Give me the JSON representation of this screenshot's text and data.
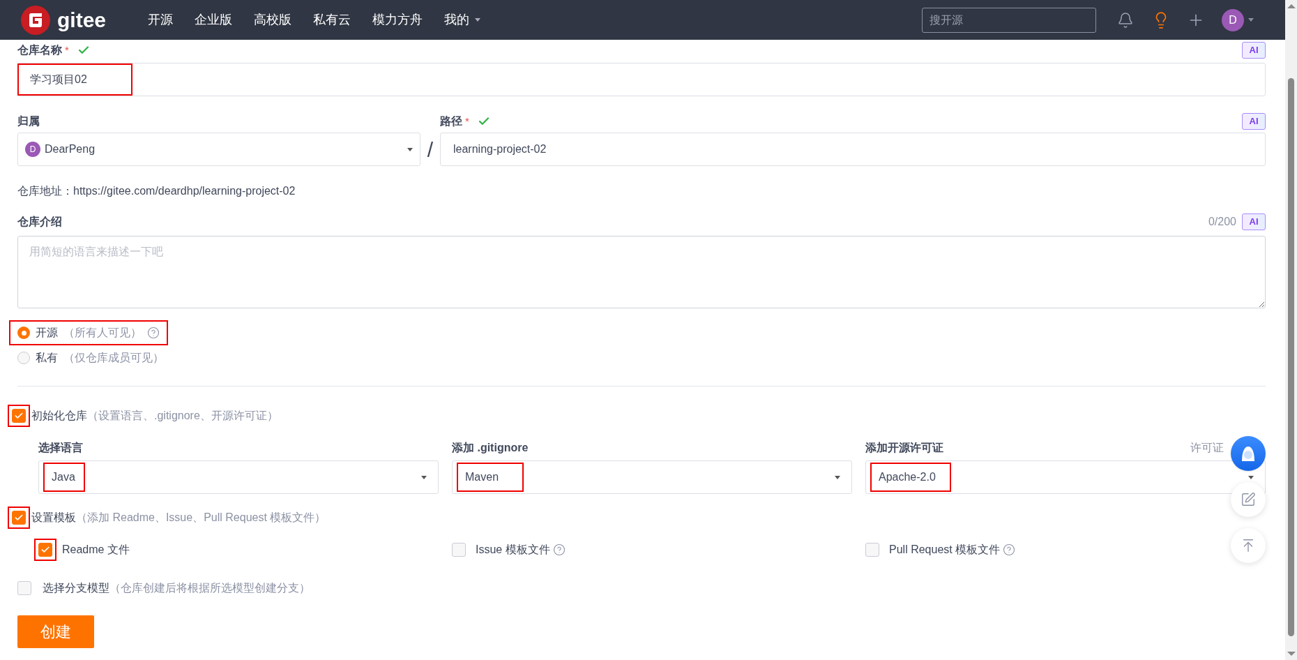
{
  "navbar": {
    "logo_text": "gitee",
    "menu": [
      {
        "label": "开源",
        "dropdown": false
      },
      {
        "label": "企业版",
        "dropdown": false
      },
      {
        "label": "高校版",
        "dropdown": false
      },
      {
        "label": "私有云",
        "dropdown": false
      },
      {
        "label": "模力方舟",
        "dropdown": false
      },
      {
        "label": "我的",
        "dropdown": true
      }
    ],
    "search": {
      "placeholder": "搜开源"
    },
    "avatar": "D"
  },
  "name_field": {
    "label": "仓库名称",
    "required": "*",
    "valid": true,
    "value": "学习项目02",
    "annotated": true,
    "ai": "AI"
  },
  "owner_field": {
    "label": "归属",
    "avatar": "D",
    "value": "DearPeng"
  },
  "separator": "/",
  "path_field": {
    "label": "路径",
    "required": "*",
    "valid": true,
    "value": "learning-project-02",
    "annotated": false,
    "ai": "AI"
  },
  "address": "仓库地址：https://gitee.com/deardhp/learning-project-02",
  "description": {
    "label": "仓库介绍",
    "counter": "0/200",
    "ai": "AI",
    "placeholder": "用简短的语言来描述一下吧"
  },
  "visibility": [
    {
      "label": "开源",
      "hint": "（所有人可见）",
      "selected": true,
      "help": true,
      "annotated": true
    },
    {
      "label": "私有",
      "hint": "（仅仓库成员可见）",
      "selected": false,
      "help": false,
      "annotated": false
    }
  ],
  "init": {
    "label": "初始化仓库",
    "hint": "（设置语言、.gitignore、开源许可证）",
    "checked": true,
    "annotated": true
  },
  "init_selects": [
    {
      "label": "选择语言",
      "value": "Java",
      "annotated": true
    },
    {
      "label": "添加 .gitignore",
      "value": "Maven",
      "annotated": true
    },
    {
      "label": "添加开源许可证",
      "value": "Apache-2.0",
      "annotated": true,
      "link": "许可证"
    }
  ],
  "templates": {
    "label": "设置模板",
    "hint": "（添加 Readme、Issue、Pull Request 模板文件）",
    "checked": true,
    "annotated": true,
    "items": [
      {
        "label": "Readme 文件",
        "checked": true,
        "annotated": true,
        "help": false
      },
      {
        "label": "Issue 模板文件",
        "checked": false,
        "annotated": false,
        "help": true
      },
      {
        "label": "Pull Request 模板文件",
        "checked": false,
        "annotated": false,
        "help": true
      }
    ]
  },
  "branch": {
    "label": "选择分支模型",
    "hint": "（仓库创建后将根据所选模型创建分支）",
    "checked": false,
    "annotated": false
  },
  "submit": "创建"
}
